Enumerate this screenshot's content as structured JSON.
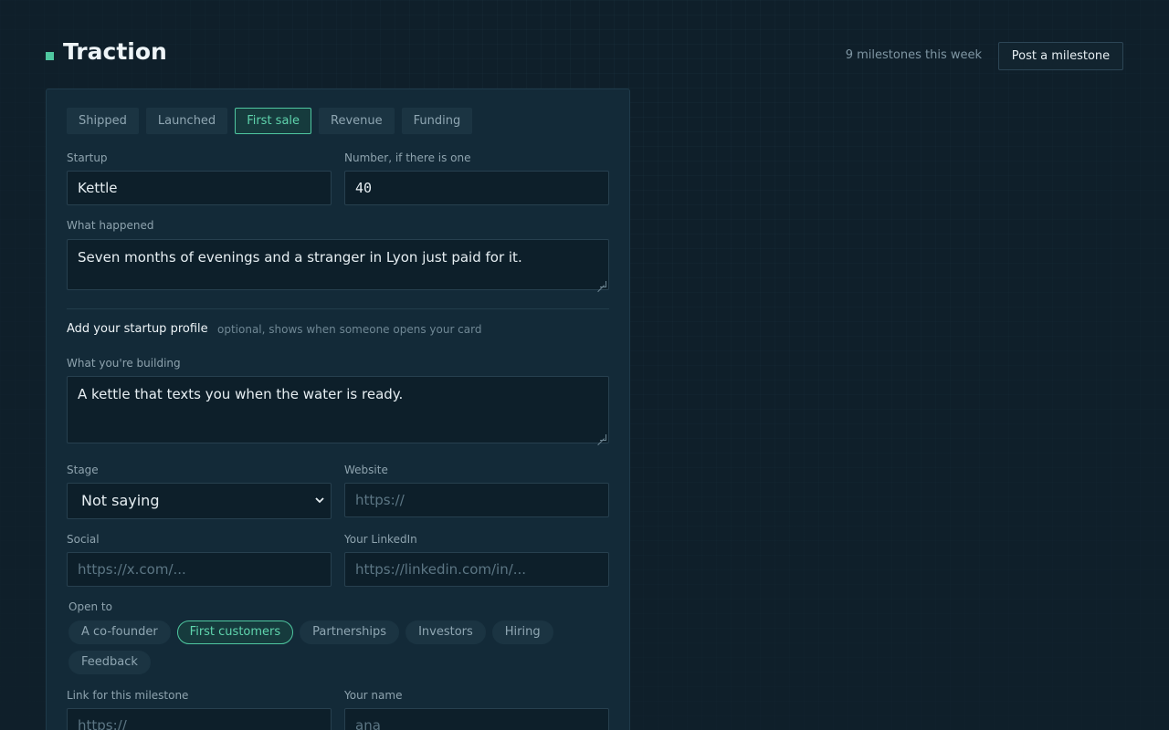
{
  "header": {
    "title": "Traction",
    "week_count": "9 milestones this week",
    "post_button": "Post a milestone"
  },
  "tabs": [
    {
      "label": "Shipped",
      "active": false
    },
    {
      "label": "Launched",
      "active": false
    },
    {
      "label": "First sale",
      "active": true
    },
    {
      "label": "Revenue",
      "active": false
    },
    {
      "label": "Funding",
      "active": false
    }
  ],
  "form": {
    "startup_label": "Startup",
    "startup_value": "Kettle",
    "number_label": "Number, if there is one",
    "number_value": "40",
    "what_happened_label": "What happened",
    "what_happened_value": "Seven months of evenings and a stranger in Lyon just paid for it.",
    "profile_title": "Add your startup profile",
    "profile_note": "optional, shows when someone opens your card",
    "building_label": "What you're building",
    "building_value": "A kettle that texts you when the water is ready.",
    "stage_label": "Stage",
    "stage_value": "Not saying",
    "website_label": "Website",
    "website_placeholder": "https://",
    "social_label": "Social",
    "social_placeholder": "https://x.com/...",
    "linkedin_label": "Your LinkedIn",
    "linkedin_placeholder": "https://linkedin.com/in/...",
    "open_to_label": "Open to",
    "open_to": [
      {
        "label": "A co-founder",
        "active": false
      },
      {
        "label": "First customers",
        "active": true
      },
      {
        "label": "Partnerships",
        "active": false
      },
      {
        "label": "Investors",
        "active": false
      },
      {
        "label": "Hiring",
        "active": false
      },
      {
        "label": "Feedback",
        "active": false
      }
    ],
    "link_label": "Link for this milestone",
    "link_placeholder": "https://",
    "name_label": "Your name",
    "name_placeholder": "ana"
  },
  "colors": {
    "accent": "#4fc7a0",
    "background": "#0f1f2a",
    "card": "#132a38"
  }
}
